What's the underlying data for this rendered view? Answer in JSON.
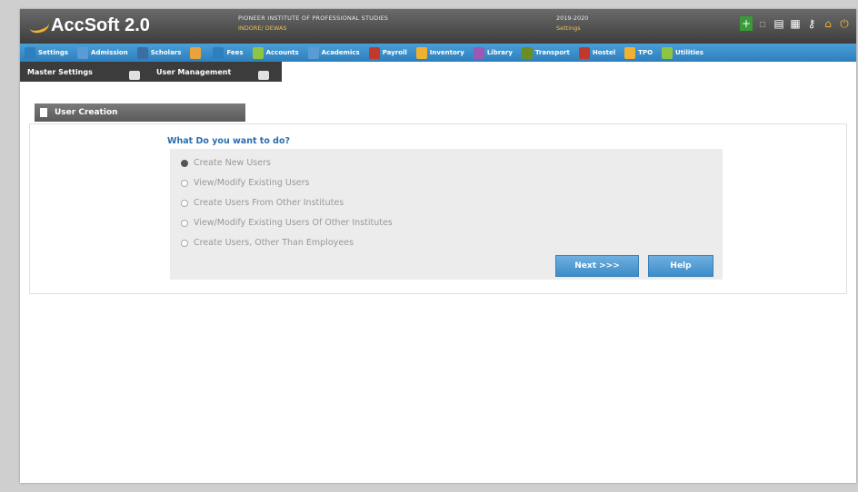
{
  "app": {
    "name": "AccSoft 2.0"
  },
  "header": {
    "institute": "PIONEER INSTITUTE OF PROFESSIONAL STUDIES",
    "location": "INDORE/ DEWAS",
    "year": "2019-2020",
    "module": "Settings"
  },
  "menu": [
    {
      "label": "Settings",
      "color": "#2e7fbd"
    },
    {
      "label": "Admission",
      "color": "#5a9bd5"
    },
    {
      "label": "Scholars",
      "color": "#3a6ea5"
    },
    {
      "label": "",
      "color": "#e8a33c"
    },
    {
      "label": "Fees",
      "color": "#2e7fbd"
    },
    {
      "label": "Accounts",
      "color": "#8ec641"
    },
    {
      "label": "Academics",
      "color": "#5a9bd5"
    },
    {
      "label": "Payroll",
      "color": "#c0392b"
    },
    {
      "label": "Inventory",
      "color": "#f0b030"
    },
    {
      "label": "Library",
      "color": "#9b59b6"
    },
    {
      "label": "Transport",
      "color": "#6b8e23"
    },
    {
      "label": "Hostel",
      "color": "#c0392b"
    },
    {
      "label": "TPO",
      "color": "#f0b030"
    },
    {
      "label": "Utilities",
      "color": "#8ec641"
    }
  ],
  "submenu": [
    "Master Settings",
    "User Management"
  ],
  "section_title": "User Creation",
  "question": "What Do you want to do?",
  "options": [
    {
      "label": "Create New Users",
      "selected": true
    },
    {
      "label": "View/Modify Existing Users",
      "selected": false
    },
    {
      "label": "Create Users From Other Institutes",
      "selected": false
    },
    {
      "label": "View/Modify Existing Users Of Other Institutes",
      "selected": false
    },
    {
      "label": "Create Users, Other Than Employees",
      "selected": false
    }
  ],
  "buttons": {
    "next": "Next >>>",
    "help": "Help"
  },
  "tool_icons": [
    "add-icon",
    "minus-icon",
    "document-icon",
    "document-edit-icon",
    "key-icon",
    "home-icon",
    "power-icon"
  ]
}
